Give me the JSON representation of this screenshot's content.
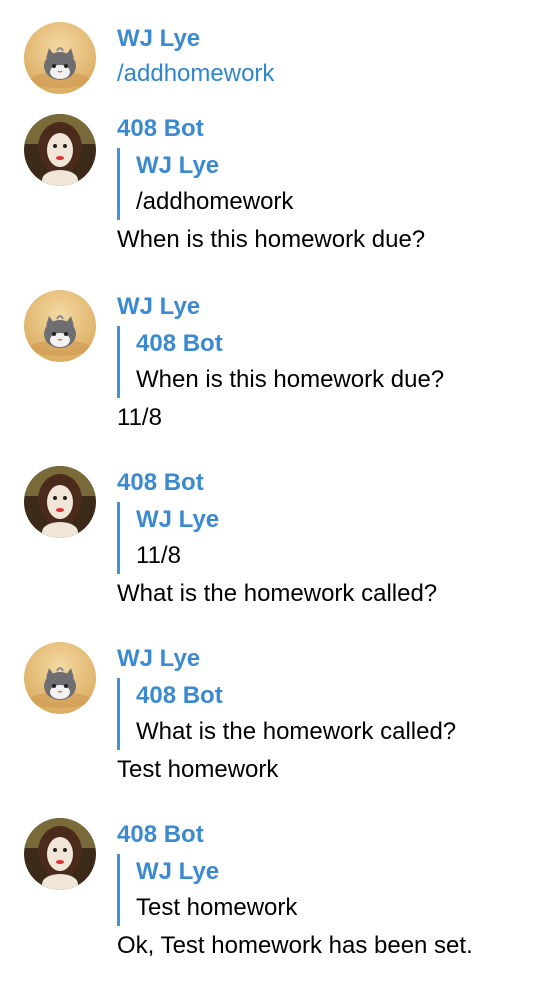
{
  "colors": {
    "name": "#3b8ad0",
    "quote_bar": "#3f93da",
    "link": "#2f86cf",
    "text": "#000000"
  },
  "messages": [
    {
      "sender": "WJ Lye",
      "avatar_icon": "cat-plush-avatar-icon",
      "text": "/addhomework"
    },
    {
      "sender": "408 Bot",
      "avatar_icon": "mona-lisa-figure-avatar-icon",
      "reply": {
        "author": "WJ Lye",
        "text": "/addhomework"
      },
      "text": "When is this homework due?"
    },
    {
      "sender": "WJ Lye",
      "avatar_icon": "cat-plush-avatar-icon",
      "reply": {
        "author": "408 Bot",
        "text": "When is this homework due?"
      },
      "text": "11/8"
    },
    {
      "sender": "408 Bot",
      "avatar_icon": "mona-lisa-figure-avatar-icon",
      "reply": {
        "author": "WJ Lye",
        "text": "11/8"
      },
      "text": "What is the homework called?"
    },
    {
      "sender": "WJ Lye",
      "avatar_icon": "cat-plush-avatar-icon",
      "reply": {
        "author": "408 Bot",
        "text": "What is the homework called?"
      },
      "text": "Test homework"
    },
    {
      "sender": "408 Bot",
      "avatar_icon": "mona-lisa-figure-avatar-icon",
      "reply": {
        "author": "WJ Lye",
        "text": "Test homework"
      },
      "text": "Ok, Test homework has been set."
    }
  ]
}
